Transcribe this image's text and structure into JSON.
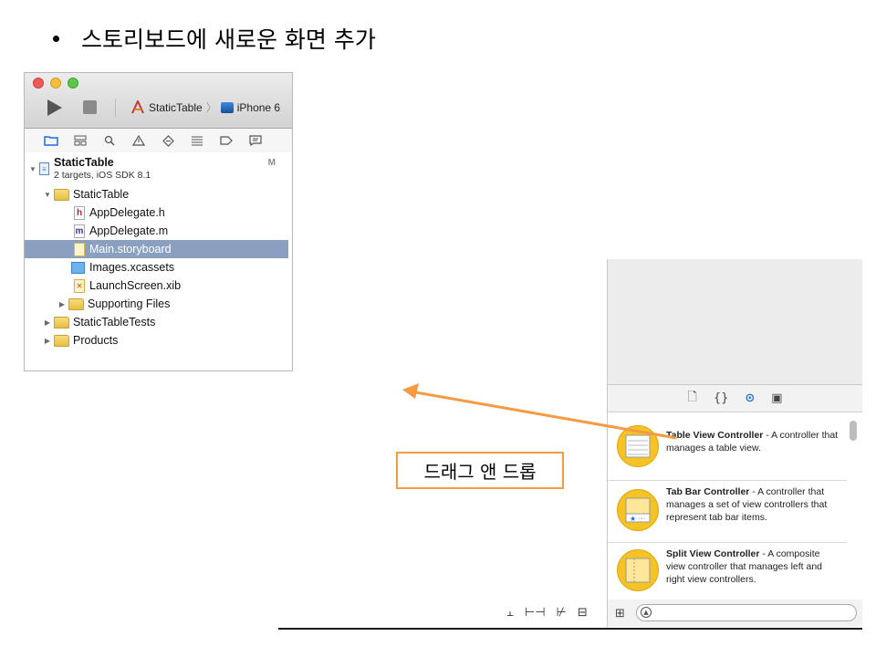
{
  "slide": {
    "bullet": "스토리보드에 새로운 화면 추가",
    "drag_label": "드래그 앤 드롭"
  },
  "toolbar": {
    "scheme": "StaticTable",
    "device": "iPhone 6"
  },
  "navigator": {
    "project": {
      "name": "StaticTable",
      "subtitle": "2 targets, iOS SDK 8.1",
      "badge": "M"
    },
    "group": "StaticTable",
    "files": [
      "AppDelegate.h",
      "AppDelegate.m",
      "Main.storyboard",
      "Images.xcassets",
      "LaunchScreen.xib"
    ],
    "supporting": "Supporting Files",
    "tests": "StaticTableTests",
    "products": "Products"
  },
  "library": {
    "items": [
      {
        "title": "Table View Controller",
        "desc": " - A controller that manages a table view."
      },
      {
        "title": "Tab Bar Controller",
        "desc": " - A controller that manages a set of view controllers that represent tab bar items."
      },
      {
        "title": "Split View Controller",
        "desc": " - A composite view controller that manages left and right view controllers."
      }
    ]
  },
  "colors": {
    "selection": "#8ba0c0",
    "accent": "#1d6fdc",
    "arrow": "#f59b42",
    "library_icon": "#f6c325"
  }
}
